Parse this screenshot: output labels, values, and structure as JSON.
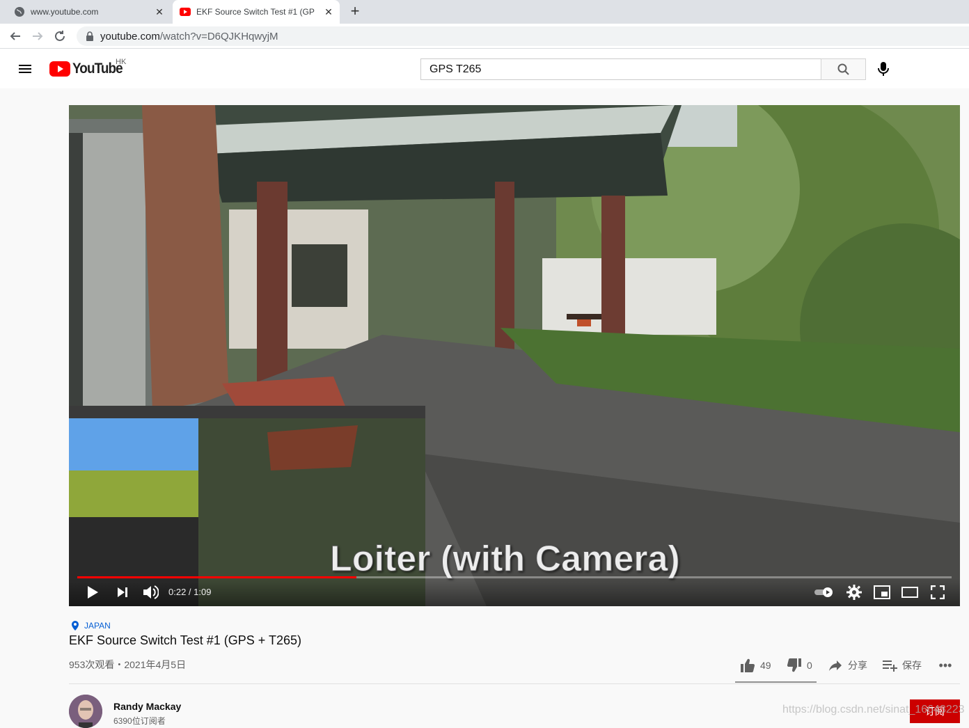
{
  "browser": {
    "tabs": [
      {
        "title": "www.youtube.com",
        "active": false
      },
      {
        "title": "EKF Source Switch Test #1 (GP",
        "active": true
      }
    ],
    "url_host": "youtube.com",
    "url_path": "/watch?v=D6QJKHqwyjM"
  },
  "header": {
    "logo_text": "YouTube",
    "region": "HK",
    "search_value": "GPS T265"
  },
  "player": {
    "caption": "Loiter (with Camera)",
    "time_display": "0:22 / 1:09",
    "progress_fraction": 0.319
  },
  "video": {
    "location": "JAPAN",
    "title": "EKF Source Switch Test #1 (GPS + T265)",
    "view_info": "953次观看・2021年4月5日",
    "likes": "49",
    "dislikes": "0",
    "share_label": "分享",
    "save_label": "保存"
  },
  "channel": {
    "name": "Randy Mackay",
    "subscribers": "6390位订阅者",
    "subscribe_label": "订阅"
  },
  "watermark": "https://blog.csdn.net/sinat_16643223",
  "colors": {
    "youtube_red": "#ff0000",
    "link_blue": "#065fd4",
    "subscribe_red": "#cc0000"
  }
}
